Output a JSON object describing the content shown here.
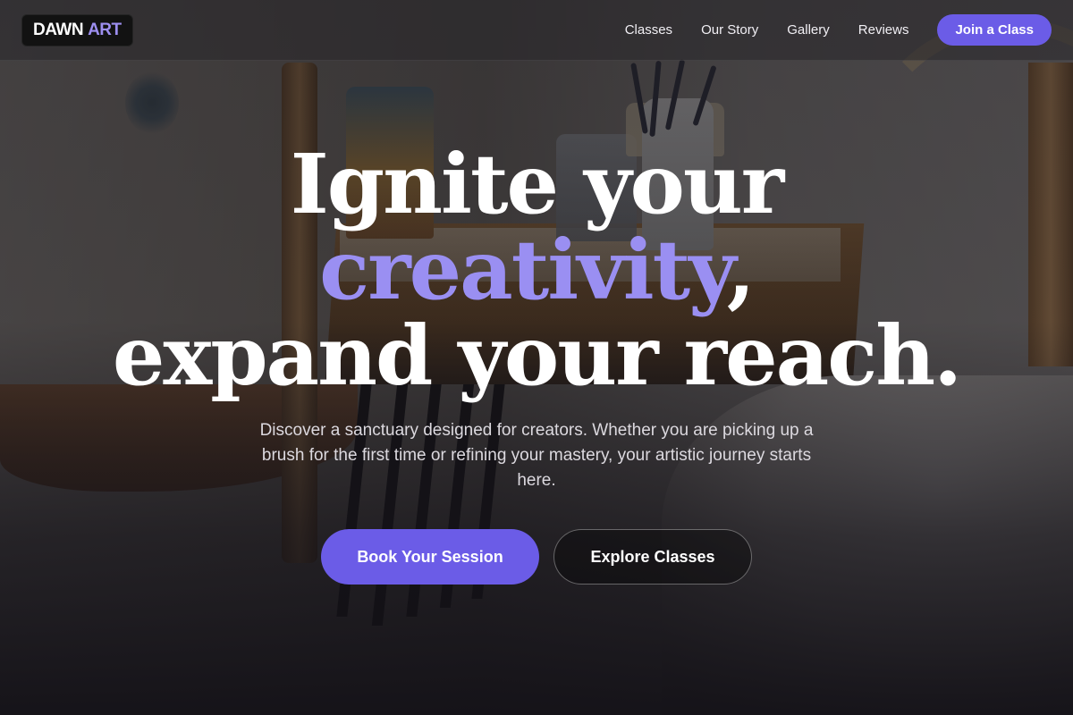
{
  "brand": {
    "logo_word1": "DAWN",
    "logo_word2": "ART",
    "accent_color": "#6b5ce7",
    "accent_text_color": "#9a8ff2"
  },
  "nav": {
    "links": [
      {
        "label": "Classes"
      },
      {
        "label": "Our Story"
      },
      {
        "label": "Gallery"
      },
      {
        "label": "Reviews"
      }
    ],
    "cta_label": "Join a Class"
  },
  "hero": {
    "headline_line1": "Ignite your",
    "headline_accent": "creativity",
    "headline_comma": ",",
    "headline_line3": "expand your reach.",
    "subtitle": "Discover a sanctuary designed for creators. Whether you are picking up a brush for the first time or refining your mastery, your artistic journey starts here.",
    "primary_button": "Book Your Session",
    "secondary_button": "Explore Classes"
  }
}
